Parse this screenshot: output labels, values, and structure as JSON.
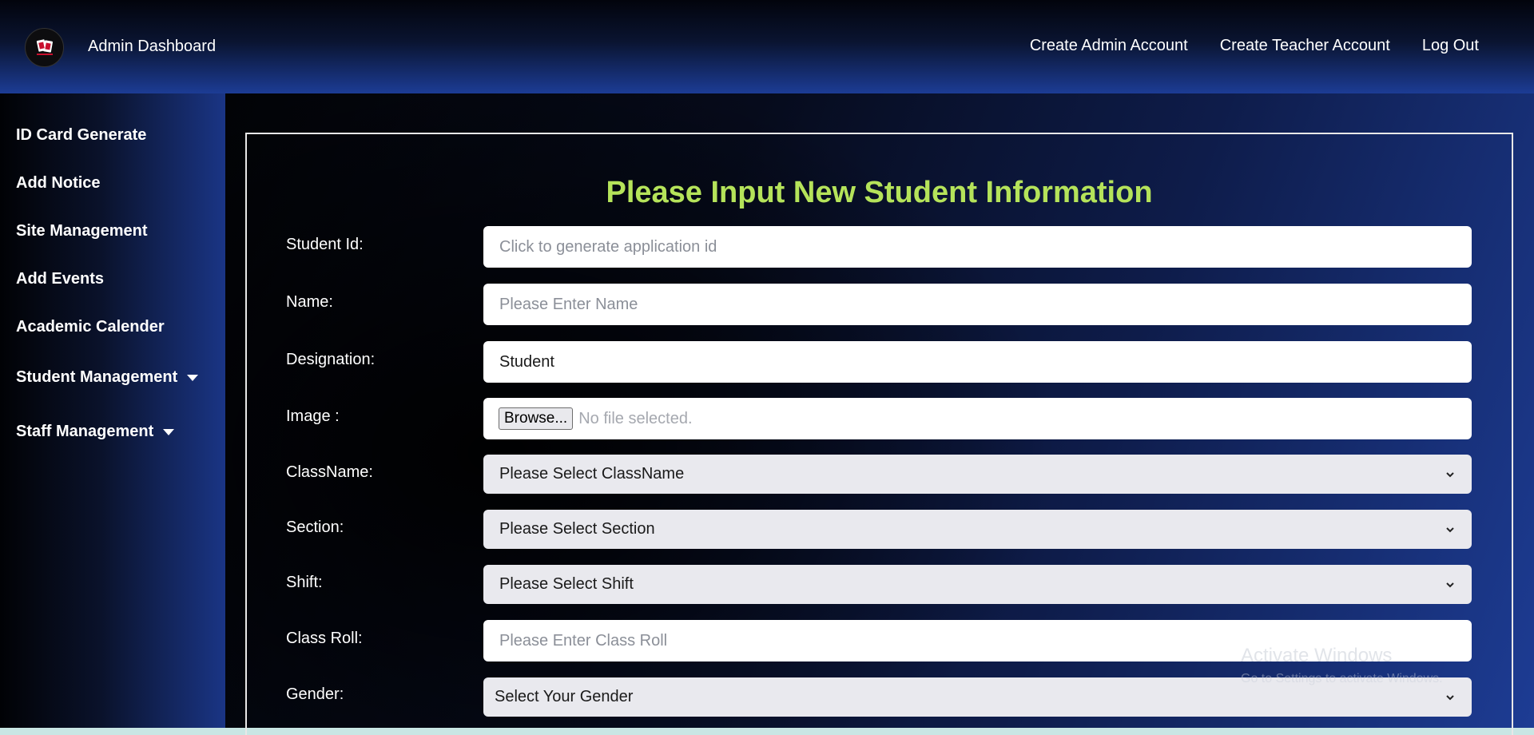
{
  "header": {
    "brand": "Admin Dashboard",
    "nav": [
      "Create Admin Account",
      "Create Teacher Account",
      "Log Out"
    ]
  },
  "sidebar": {
    "items": [
      {
        "label": "ID Card Generate"
      },
      {
        "label": "Add Notice"
      },
      {
        "label": "Site Management"
      },
      {
        "label": "Add Events"
      },
      {
        "label": "Academic Calender"
      },
      {
        "label": "Student Management"
      },
      {
        "label": "Staff Management"
      }
    ]
  },
  "form": {
    "title": "Please Input New Student Information",
    "fields": {
      "student_id": {
        "label": "Student Id:",
        "placeholder": "Click to generate application id"
      },
      "name": {
        "label": "Name:",
        "placeholder": "Please Enter Name"
      },
      "designation": {
        "label": "Designation:",
        "value": "Student"
      },
      "image": {
        "label": "Image :",
        "button": "Browse...",
        "status": "No file selected."
      },
      "classname": {
        "label": "ClassName:",
        "selected": "Please Select ClassName"
      },
      "section": {
        "label": "Section:",
        "selected": "Please Select Section"
      },
      "shift": {
        "label": "Shift:",
        "selected": "Please Select Shift"
      },
      "class_roll": {
        "label": "Class Roll:",
        "placeholder": "Please Enter Class Roll"
      },
      "gender": {
        "label": "Gender:",
        "selected": "Select Your Gender"
      }
    }
  },
  "watermark": {
    "line1": "Activate Windows",
    "line2": "Go to Settings to activate Windows."
  },
  "colors": {
    "title_accent": "#b5e35a",
    "header_gradient_end": "#1c3c95"
  }
}
